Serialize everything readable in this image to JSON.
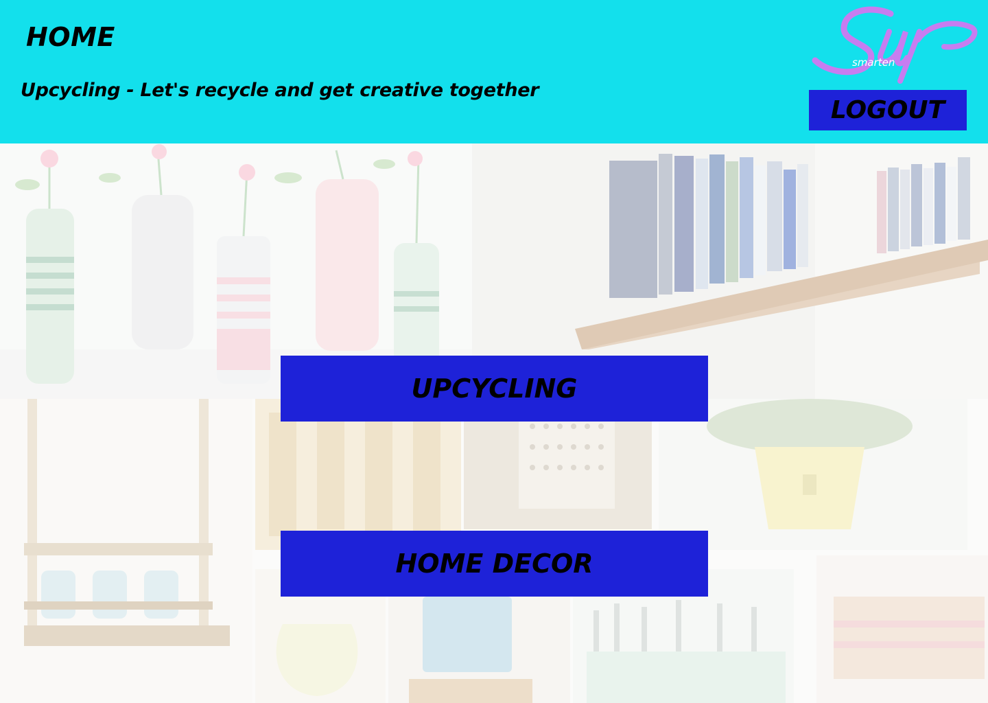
{
  "header": {
    "title": "HOME",
    "tagline": "Upcycling - Let's recycle and get creative together",
    "logo": {
      "main_text": "Sup",
      "sub_text": "smarten",
      "color": "#c77df0"
    },
    "logout_label": "LOGOUT"
  },
  "colors": {
    "header_bg": "#13e0ec",
    "button_bg": "#1e22d8",
    "button_text": "#000000"
  },
  "main": {
    "buttons": [
      {
        "label": "UPCYCLING"
      },
      {
        "label": "HOME DECOR"
      }
    ]
  }
}
